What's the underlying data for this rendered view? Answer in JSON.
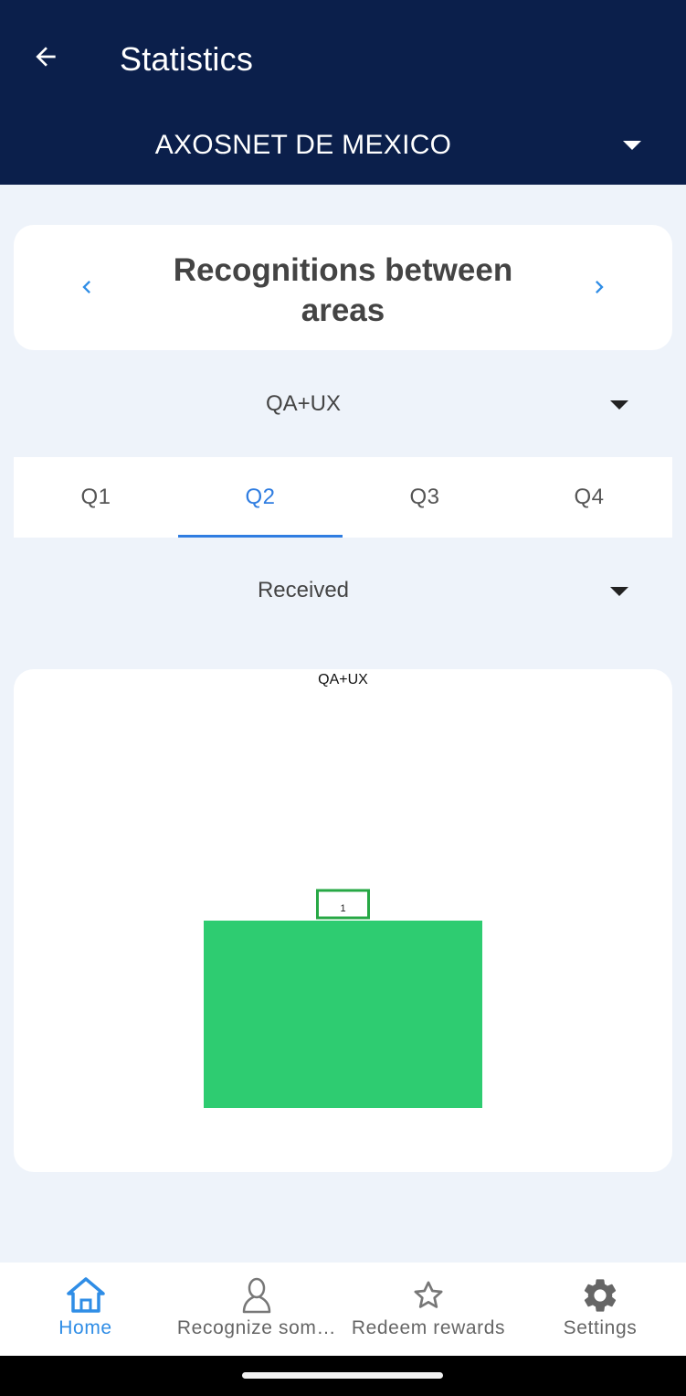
{
  "header": {
    "title": "Statistics",
    "company": "AXOSNET DE MEXICO"
  },
  "card": {
    "title": "Recognitions between areas"
  },
  "area_filter": {
    "selected": "QA+UX"
  },
  "tabs": [
    {
      "label": "Q1",
      "active": false
    },
    {
      "label": "Q2",
      "active": true
    },
    {
      "label": "Q3",
      "active": false
    },
    {
      "label": "Q4",
      "active": false
    }
  ],
  "direction_filter": {
    "selected": "Received"
  },
  "chart_data": {
    "type": "bar",
    "title": "QA+UX",
    "categories": [
      ""
    ],
    "values": [
      1
    ],
    "data_labels": [
      "1"
    ],
    "ylim": [
      0,
      2
    ],
    "bar_color": "#2ecc71",
    "label_border_color": "#27a845",
    "grid": false
  },
  "bottom_nav": [
    {
      "label": "Home",
      "icon": "home-icon",
      "active": true
    },
    {
      "label": "Recognize som…",
      "icon": "person-icon",
      "active": false
    },
    {
      "label": "Redeem rewards",
      "icon": "star-icon",
      "active": false
    },
    {
      "label": "Settings",
      "icon": "gear-icon",
      "active": false
    }
  ],
  "colors": {
    "header_bg": "#0b1f4b",
    "accent": "#2f7de1",
    "page_bg": "#eef3fa"
  }
}
